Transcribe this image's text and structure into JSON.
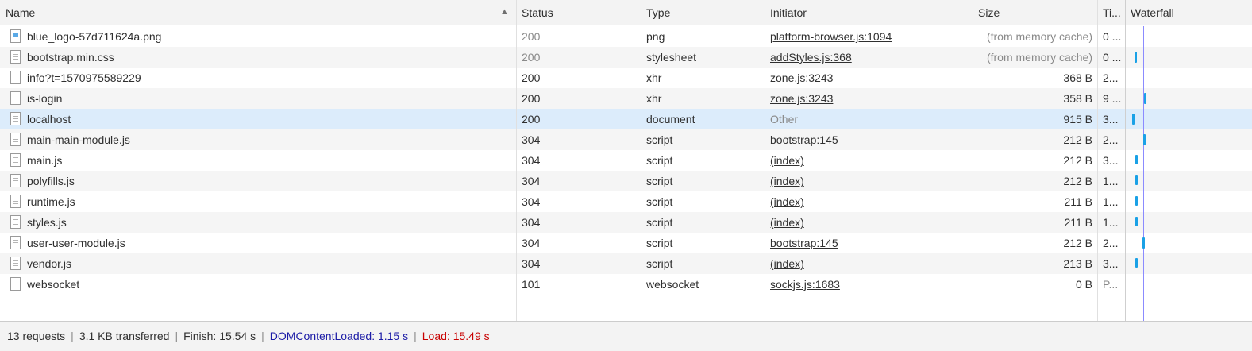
{
  "columns": {
    "name": "Name",
    "status": "Status",
    "type": "Type",
    "initiator": "Initiator",
    "size": "Size",
    "time": "Ti...",
    "waterfall": "Waterfall"
  },
  "sort_indicator": "▲",
  "requests": [
    {
      "name": "blue_logo-57d711624a.png",
      "icon": "image-file-icon",
      "status": "200",
      "type": "png",
      "initiator": "platform-browser.js:1094",
      "size": "(from memory cache)",
      "time": "0 ..."
    },
    {
      "name": "bootstrap.min.css",
      "icon": "document-file-icon",
      "status": "200",
      "type": "stylesheet",
      "initiator": "addStyles.js:368",
      "size": "(from memory cache)",
      "time": "0 ..."
    },
    {
      "name": "info?t=1570975589229",
      "icon": "blank-file-icon",
      "status": "200",
      "type": "xhr",
      "initiator": "zone.js:3243",
      "size": "368 B",
      "time": "2..."
    },
    {
      "name": "is-login",
      "icon": "blank-file-icon",
      "status": "200",
      "type": "xhr",
      "initiator": "zone.js:3243",
      "size": "358 B",
      "time": "9 ..."
    },
    {
      "name": "localhost",
      "icon": "document-file-icon",
      "status": "200",
      "type": "document",
      "initiator": "Other",
      "size": "915 B",
      "time": "3..."
    },
    {
      "name": "main-main-module.js",
      "icon": "document-file-icon",
      "status": "304",
      "type": "script",
      "initiator": "bootstrap:145",
      "size": "212 B",
      "time": "2..."
    },
    {
      "name": "main.js",
      "icon": "document-file-icon",
      "status": "304",
      "type": "script",
      "initiator": "(index)",
      "size": "212 B",
      "time": "3..."
    },
    {
      "name": "polyfills.js",
      "icon": "document-file-icon",
      "status": "304",
      "type": "script",
      "initiator": "(index)",
      "size": "212 B",
      "time": "1..."
    },
    {
      "name": "runtime.js",
      "icon": "document-file-icon",
      "status": "304",
      "type": "script",
      "initiator": "(index)",
      "size": "211 B",
      "time": "1..."
    },
    {
      "name": "styles.js",
      "icon": "document-file-icon",
      "status": "304",
      "type": "script",
      "initiator": "(index)",
      "size": "211 B",
      "time": "1..."
    },
    {
      "name": "user-user-module.js",
      "icon": "document-file-icon",
      "status": "304",
      "type": "script",
      "initiator": "bootstrap:145",
      "size": "212 B",
      "time": "2..."
    },
    {
      "name": "vendor.js",
      "icon": "document-file-icon",
      "status": "304",
      "type": "script",
      "initiator": "(index)",
      "size": "213 B",
      "time": "3..."
    },
    {
      "name": "websocket",
      "icon": "blank-file-icon",
      "status": "101",
      "type": "websocket",
      "initiator": "sockjs.js:1683",
      "size": "0 B",
      "time": "P..."
    }
  ],
  "footer": {
    "requests": "13 requests",
    "transferred": "3.1 KB transferred",
    "finish": "Finish: 15.54 s",
    "dom_content_loaded": "DOMContentLoaded: 1.15 s",
    "load": "Load: 15.49 s"
  },
  "colors": {
    "selected_row": "#dcecfb",
    "dcl": "#1a1aa6",
    "load": "#c80000",
    "waterfall_bar": "#1aa1e6"
  }
}
